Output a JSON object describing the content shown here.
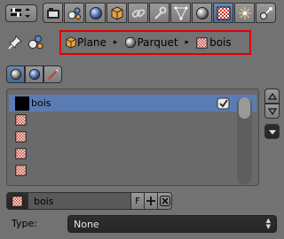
{
  "header": {
    "editor_type_icon": "properties-editor-icon",
    "tabs": [
      {
        "name": "render-tab",
        "icon": "camera-icon"
      },
      {
        "name": "scene-tab",
        "icon": "scene-icon"
      },
      {
        "name": "world-tab",
        "icon": "world-icon"
      },
      {
        "name": "object-tab",
        "icon": "cube-icon"
      },
      {
        "name": "constraints-tab",
        "icon": "chain-link-icon"
      },
      {
        "name": "modifiers-tab",
        "icon": "wrench-icon"
      },
      {
        "name": "data-tab",
        "icon": "mesh-triangle-icon"
      },
      {
        "name": "material-tab",
        "icon": "material-sphere-icon"
      },
      {
        "name": "texture-tab",
        "icon": "checker-texture-icon",
        "active": true
      },
      {
        "name": "particles-tab",
        "icon": "particles-icon"
      },
      {
        "name": "physics-tab",
        "icon": "physics-icon"
      }
    ]
  },
  "breadcrumb": {
    "items": [
      {
        "label": "Plane",
        "icon": "mesh-cube-icon"
      },
      {
        "label": "Parquet",
        "icon": "material-sphere-icon"
      },
      {
        "label": "bois",
        "icon": "checker-texture-icon"
      }
    ]
  },
  "texture_slots": {
    "items": [
      {
        "label": "bois",
        "selected": true,
        "enabled": true
      },
      {
        "label": ""
      },
      {
        "label": ""
      },
      {
        "label": ""
      },
      {
        "label": ""
      }
    ]
  },
  "datablock": {
    "name": "bois",
    "fake_user_label": "F"
  },
  "type_row": {
    "label": "Type:",
    "value": "None"
  },
  "colors": {
    "panel_bg": "#727272",
    "selection": "#5b7bb3",
    "highlight_border": "#e00000"
  }
}
